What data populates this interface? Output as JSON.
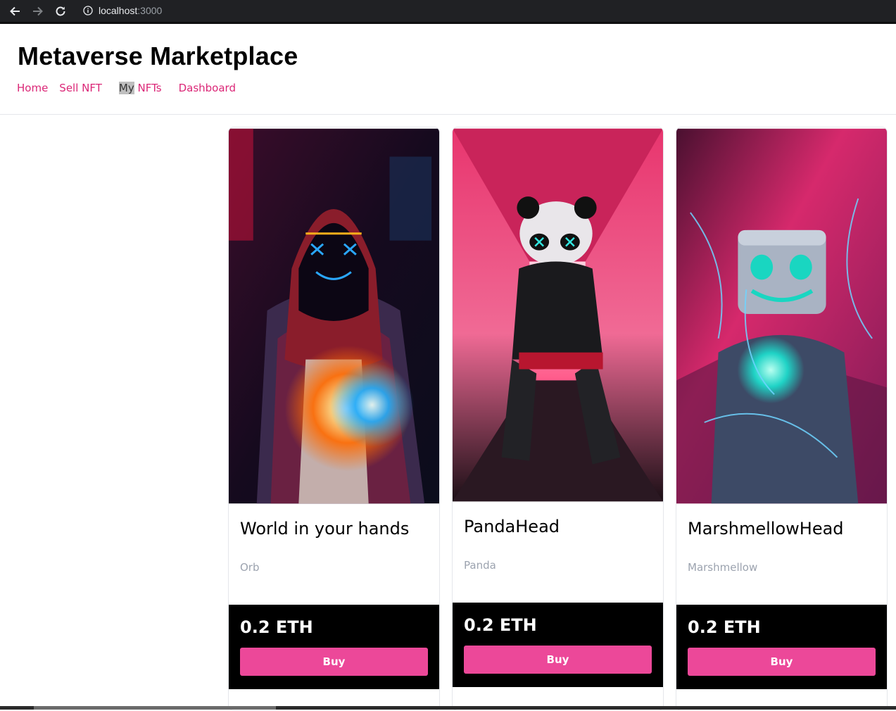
{
  "browser": {
    "host": "localhost",
    "port": ":3000"
  },
  "header": {
    "title": "Metaverse Marketplace",
    "nav": {
      "home": "Home",
      "sell": "Sell NFT",
      "my_highlight": "My",
      "my_rest": " NFTs",
      "dashboard": "Dashboard"
    }
  },
  "colors": {
    "accent": "#ec4899",
    "link": "#db2777",
    "price_bg": "#000000"
  },
  "cards": [
    {
      "name": "World in your hands",
      "description": "Orb",
      "price": "0.2 ETH",
      "buy_label": "Buy",
      "image": "hooded-neon-figure-image"
    },
    {
      "name": "PandaHead",
      "description": "Panda",
      "price": "0.2 ETH",
      "buy_label": "Buy",
      "image": "panda-head-figure-image"
    },
    {
      "name": "MarshmellowHead",
      "description": "Marshmellow",
      "price": "0.2 ETH",
      "buy_label": "Buy",
      "image": "marshmello-head-figure-image"
    }
  ]
}
